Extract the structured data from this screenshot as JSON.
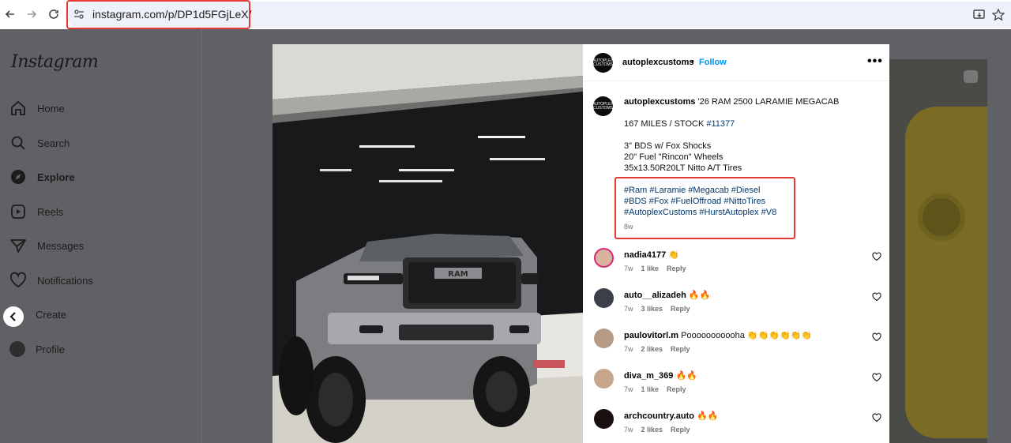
{
  "browser": {
    "url": "instagram.com/p/DP1d5FGjLeX/"
  },
  "sidebar": {
    "logo": "Instagram",
    "items": [
      {
        "label": "Home",
        "icon": "home-icon"
      },
      {
        "label": "Search",
        "icon": "search-icon"
      },
      {
        "label": "Explore",
        "icon": "explore-icon"
      },
      {
        "label": "Reels",
        "icon": "reels-icon"
      },
      {
        "label": "Messages",
        "icon": "messages-icon"
      },
      {
        "label": "Notifications",
        "icon": "heart-icon"
      },
      {
        "label": "Create",
        "icon": "plus-icon"
      },
      {
        "label": "Profile",
        "icon": "avatar"
      }
    ]
  },
  "post": {
    "author": "autoplexcustoms",
    "dot": "•",
    "follow": "Follow",
    "avatar_text": "AUTOPLEX CUSTOMS",
    "caption": {
      "title": "'26 RAM 2500 LARAMIE MEGACAB",
      "stock_prefix": "167 MILES / STOCK ",
      "stock_tag": "#11377",
      "spec1": "3\" BDS w/ Fox Shocks",
      "spec2": "20\" Fuel \"Rincon\" Wheels",
      "spec3": "35x13.50R20LT Nitto A/T Tires",
      "tags1": "#Ram #Laramie #Megacab #Diesel",
      "tags2": "#BDS #Fox #FuelOffroad #NittoTires",
      "tags3": "#AutoplexCustoms #HurstAutoplex #V8",
      "age": "8w"
    },
    "grille_text": "RAM"
  },
  "comments": [
    {
      "user": "nadia4177",
      "text": "👏",
      "age": "7w",
      "likes": "1 like",
      "reply": "Reply"
    },
    {
      "user": "auto__alizadeh",
      "text": "🔥🔥",
      "age": "7w",
      "likes": "3 likes",
      "reply": "Reply"
    },
    {
      "user": "paulovitorl.m",
      "text": "Pooooooooooha 👏👏👏👏👏👏",
      "age": "7w",
      "likes": "2 likes",
      "reply": "Reply"
    },
    {
      "user": "diva_m_369",
      "text": "🔥🔥",
      "age": "7w",
      "likes": "1 like",
      "reply": "Reply"
    },
    {
      "user": "archcountry.auto",
      "text": "🔥🔥",
      "age": "7w",
      "likes": "2 likes",
      "reply": "Reply"
    }
  ],
  "colors": {
    "accent": "#0095f6",
    "highlight": "#e53935",
    "hashtag": "#00376b"
  }
}
